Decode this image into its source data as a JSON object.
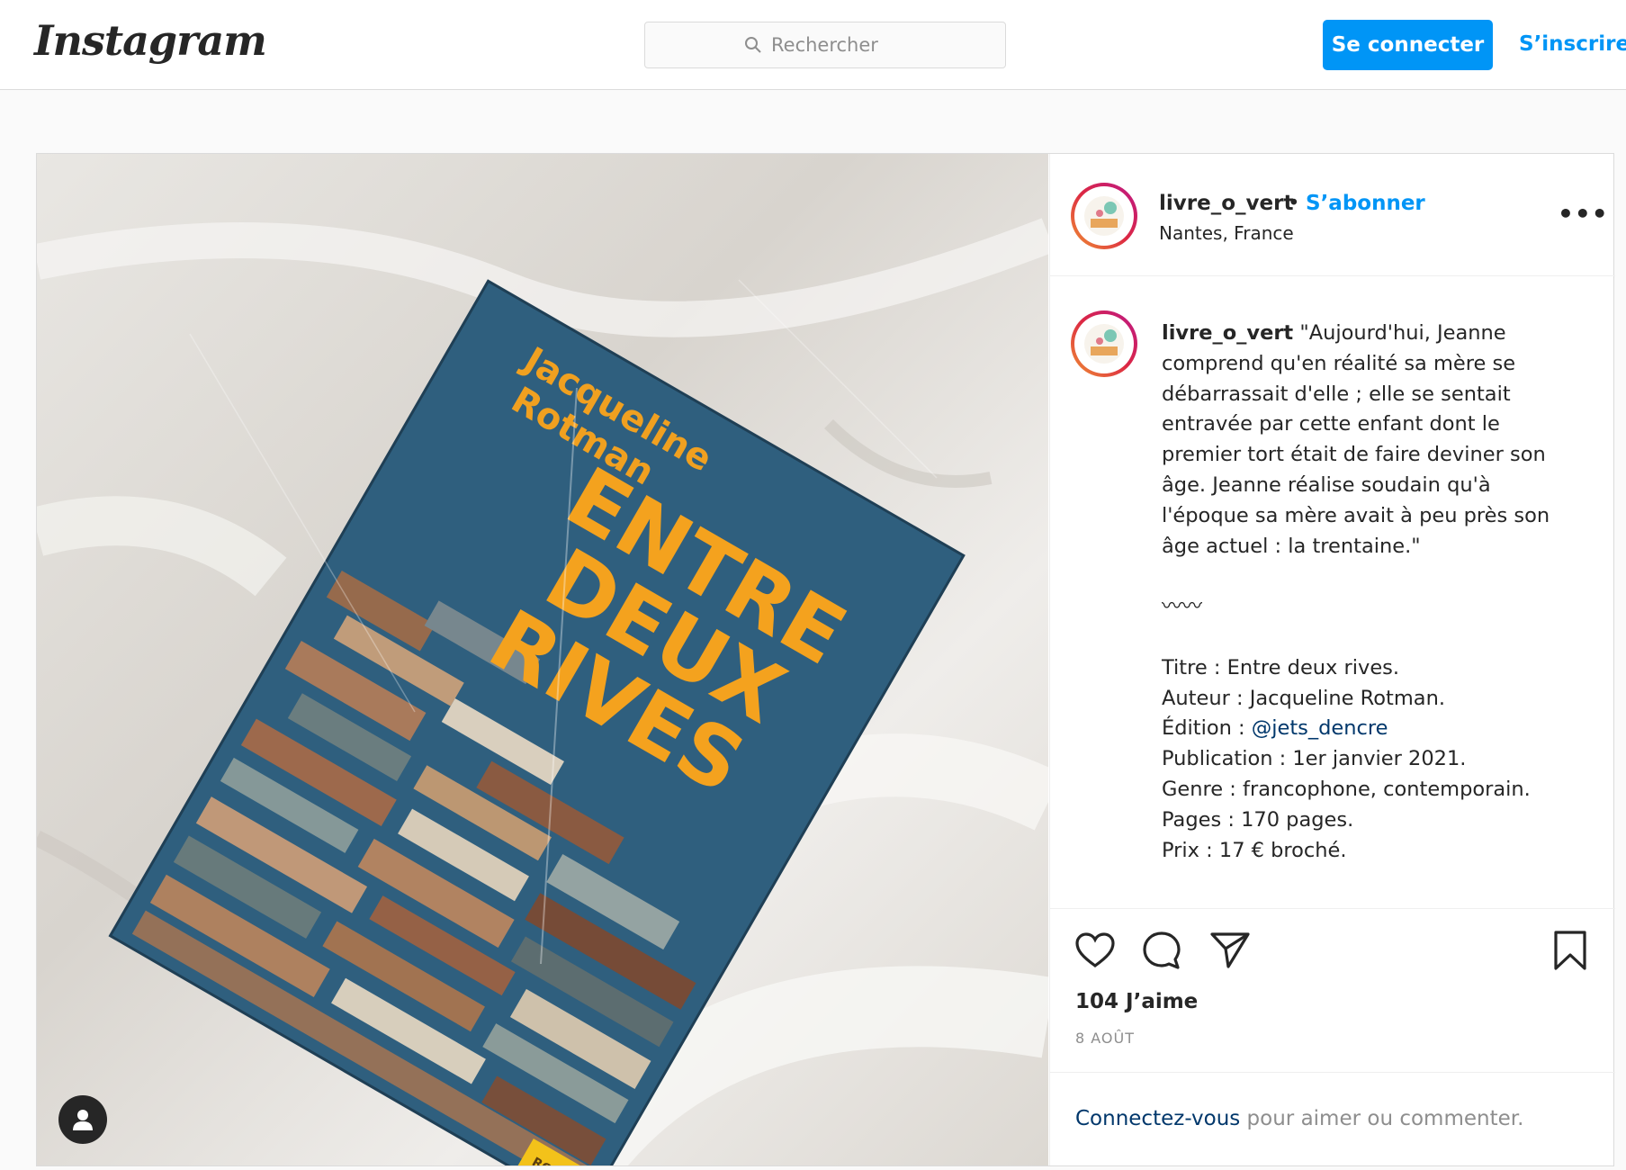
{
  "header": {
    "logo": "Instagram",
    "search_placeholder": "Rechercher",
    "login_button": "Se connecter",
    "signup_link": "S’inscrire"
  },
  "colors": {
    "accent": "#0095f6",
    "text": "#262626",
    "muted": "#8e8e8e",
    "link_dark": "#00376b"
  },
  "photo": {
    "book_author": [
      "Jacqueline",
      "Rotman"
    ],
    "book_title": [
      "ENTRE",
      "DEUX",
      "RIVES"
    ],
    "book_tag": "ROMAN"
  },
  "post": {
    "username": "livre_o_vert",
    "separator": "•",
    "follow": "S’abonner",
    "location": "Nantes, France",
    "more_icon": "•••",
    "caption_lines": [
      "\"Aujourd'hui, Jeanne",
      "comprend qu'en réalité sa mère se",
      "débarrassait d'elle ; elle se sentait",
      "entravée par cette enfant dont le",
      "premier tort était de faire deviner son",
      "âge. Jeanne réalise soudain qu'à",
      "l'époque sa mère avait à peu près son",
      "âge actuel : la trentaine.\""
    ],
    "squiggle": "〰〰",
    "details": {
      "title": "Titre : Entre deux rives.",
      "author": "Auteur : Jacqueline Rotman.",
      "edition_prefix": "Édition : ",
      "edition_mention": "@jets_dencre",
      "publication": "Publication : 1er janvier 2021.",
      "genre": "Genre : francophone, contemporain.",
      "pages": "Pages : 170 pages.",
      "price": "Prix : 17 € broché."
    },
    "likes": "104 J’aime",
    "date": "8 AOÛT",
    "login_link": "Connectez-vous",
    "login_rest": " pour aimer ou commenter."
  }
}
